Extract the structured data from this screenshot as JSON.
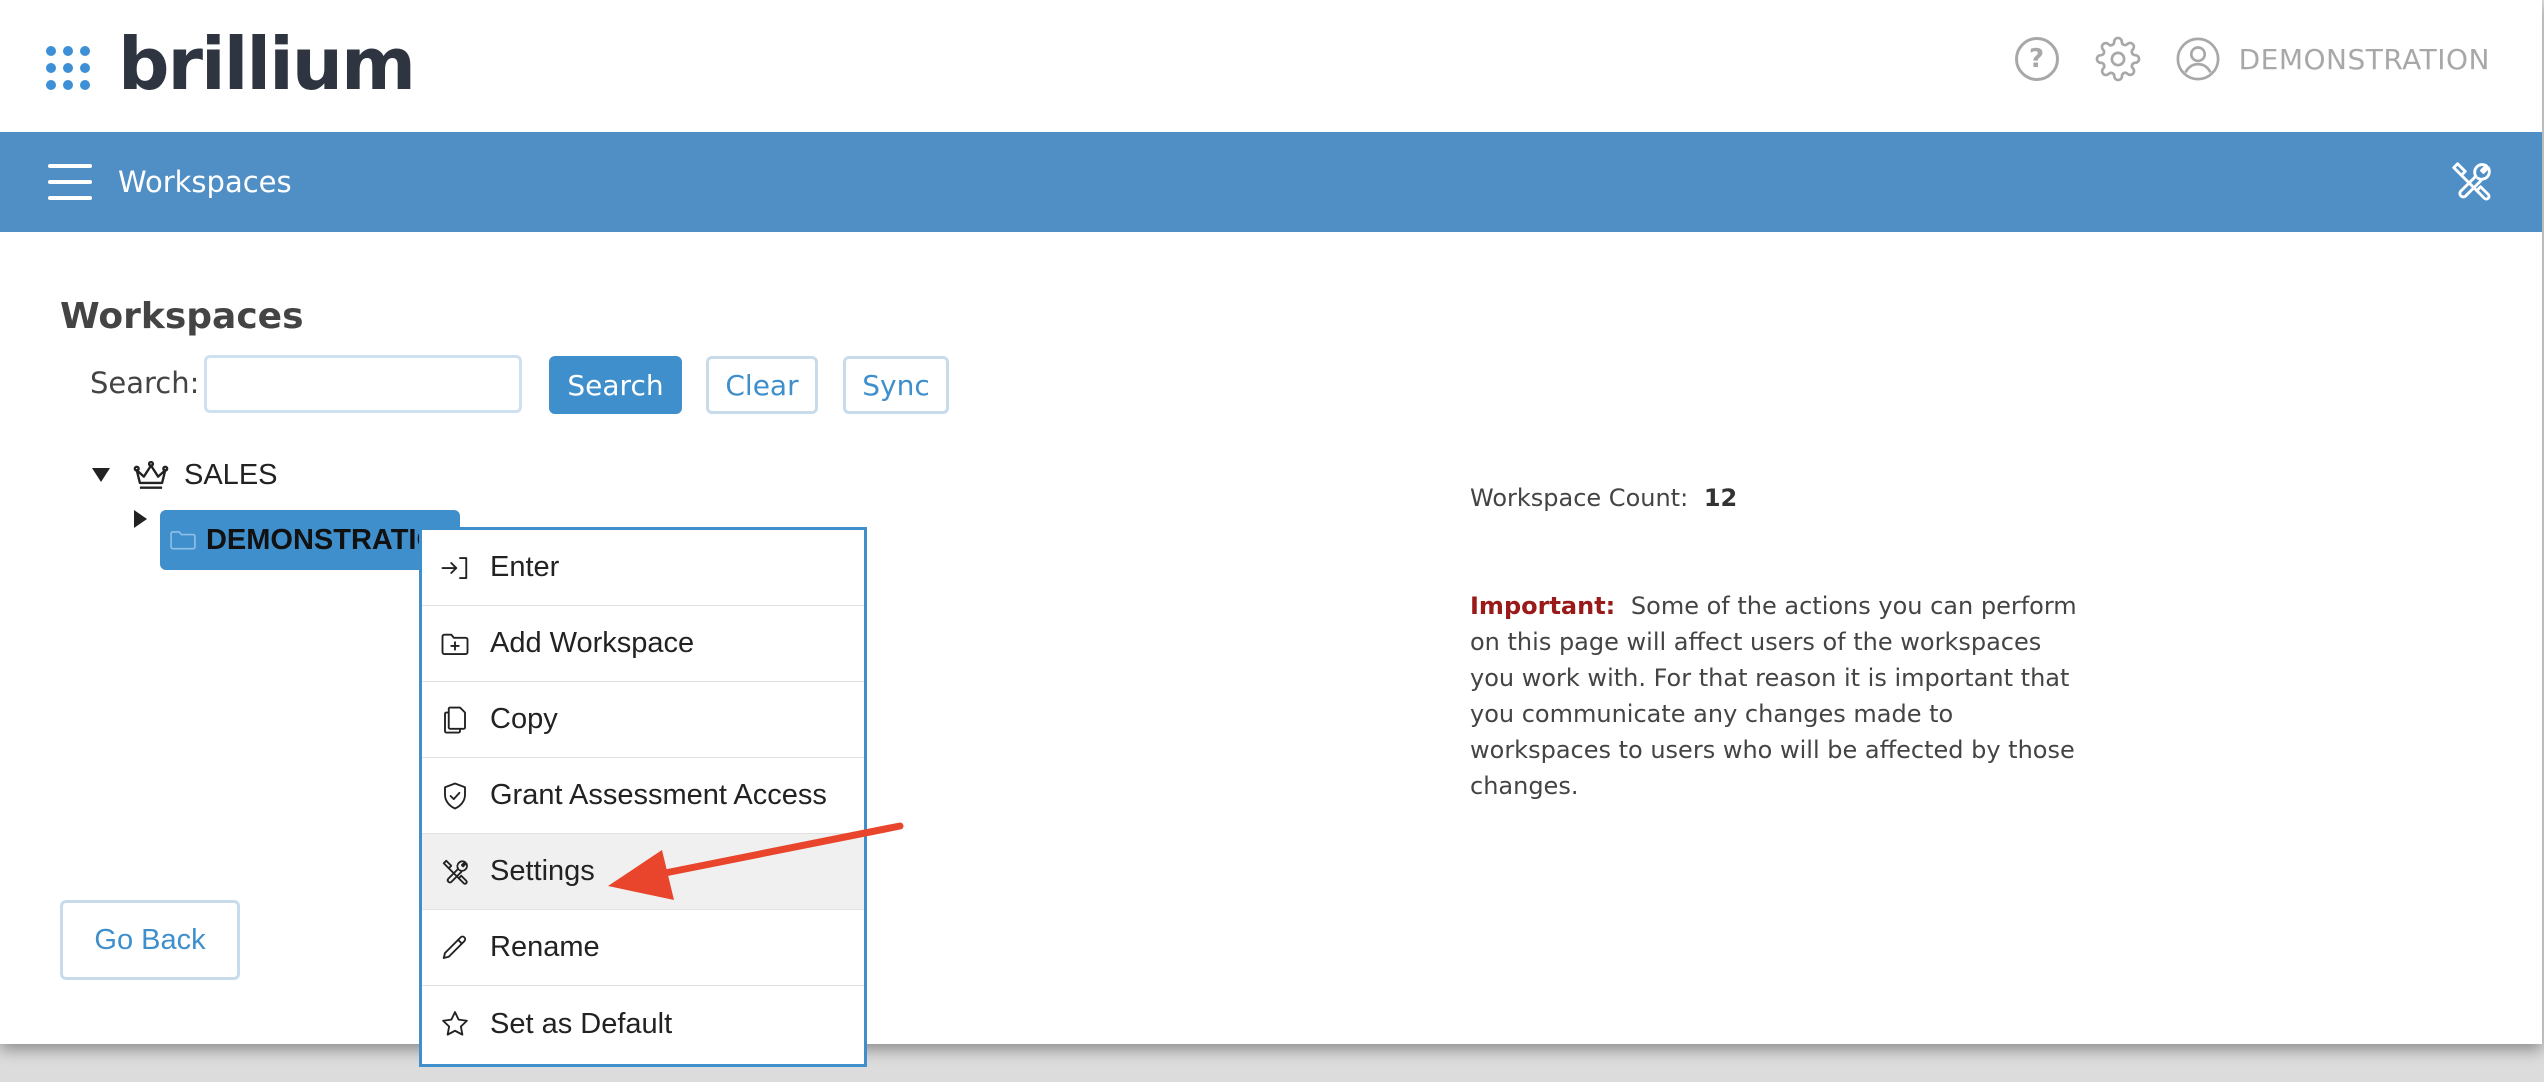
{
  "header": {
    "logo_text": "brillium",
    "user_name": "DEMONSTRATION"
  },
  "bar": {
    "title": "Workspaces"
  },
  "main": {
    "page_title": "Workspaces",
    "search_label": "Search:",
    "search_value": "",
    "search_button": "Search",
    "clear_button": "Clear",
    "sync_button": "Sync",
    "go_back": "Go Back"
  },
  "tree": {
    "root_label": "SALES",
    "child_label": "DEMONSTRATION"
  },
  "info": {
    "count_label": "Workspace Count:",
    "count_value": "12",
    "important_label": "Important:",
    "important_text": "Some of the actions you can perform on this page will affect users of the workspaces you work with. For that reason it is important that you communicate any changes made to workspaces to users who will be affected by those changes."
  },
  "menu": {
    "items": [
      {
        "label": "Enter",
        "icon": "enter-icon"
      },
      {
        "label": "Add Workspace",
        "icon": "folder-plus-icon"
      },
      {
        "label": "Copy",
        "icon": "copy-icon"
      },
      {
        "label": "Grant Assessment Access",
        "icon": "shield-check-icon"
      },
      {
        "label": "Settings",
        "icon": "tools-icon"
      },
      {
        "label": "Rename",
        "icon": "pencil-icon"
      },
      {
        "label": "Set as Default",
        "icon": "star-icon"
      }
    ]
  },
  "colors": {
    "accent": "#3f8fcc",
    "bar": "#4f8fc5",
    "important": "#9a1a1a",
    "annotation_arrow": "#e8452c"
  }
}
